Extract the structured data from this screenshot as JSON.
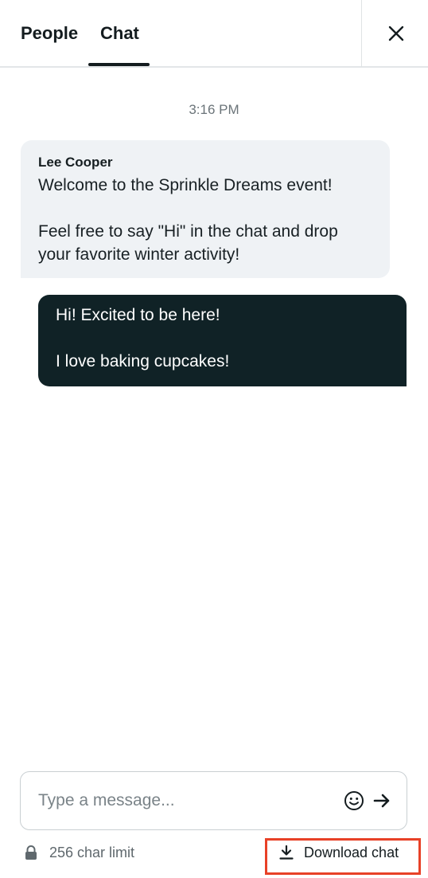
{
  "tabs": {
    "people": "People",
    "chat": "Chat"
  },
  "messages": {
    "timestamp": "3:16 PM",
    "incoming": {
      "sender": "Lee Cooper",
      "text": "Welcome to the Sprinkle Dreams event!\n\nFeel free to say \"Hi\" in the chat and drop your favorite winter activity!"
    },
    "outgoing": {
      "text": "Hi! Excited to be here!\n\nI love baking cupcakes!"
    }
  },
  "composer": {
    "placeholder": "Type a message..."
  },
  "footer": {
    "char_limit": "256 char limit",
    "download_label": "Download chat"
  },
  "icons": {
    "close": "close-icon",
    "emoji": "smiley-icon",
    "send": "arrow-right-icon",
    "lock": "lock-icon",
    "download": "download-icon"
  },
  "colors": {
    "outgoing_bubble": "#102226",
    "incoming_bubble": "#eff2f5",
    "highlight": "#e84127"
  }
}
